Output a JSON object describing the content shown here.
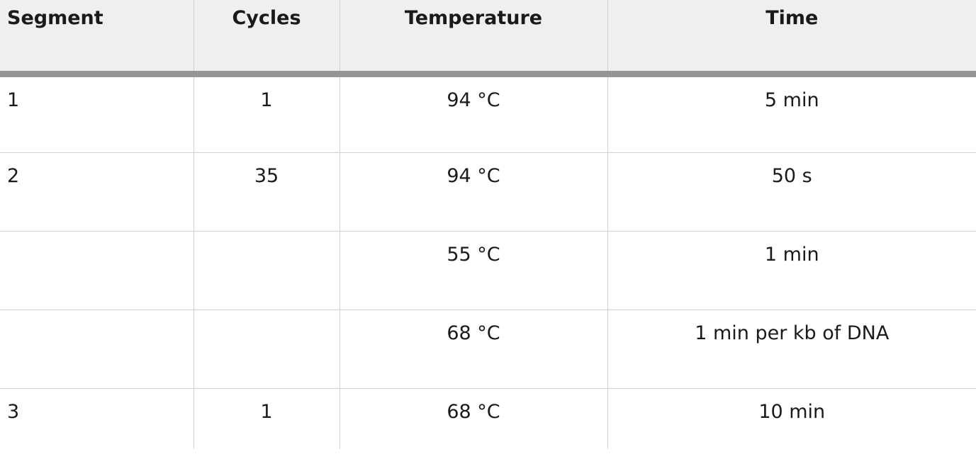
{
  "table": {
    "headers": [
      "Segment",
      "Cycles",
      "Temperature",
      "Time"
    ],
    "rows": [
      {
        "segment": "1",
        "cycles": "1",
        "temperature": "94 °C",
        "time": "5 min"
      },
      {
        "segment": "2",
        "cycles": "35",
        "temperature": "94 °C",
        "time": "50 s"
      },
      {
        "segment": "",
        "cycles": "",
        "temperature": "55 °C",
        "time": "1 min"
      },
      {
        "segment": "",
        "cycles": "",
        "temperature": "68 °C",
        "time": "1 min per kb of DNA"
      },
      {
        "segment": "3",
        "cycles": "1",
        "temperature": "68 °C",
        "time": "10 min"
      }
    ]
  }
}
